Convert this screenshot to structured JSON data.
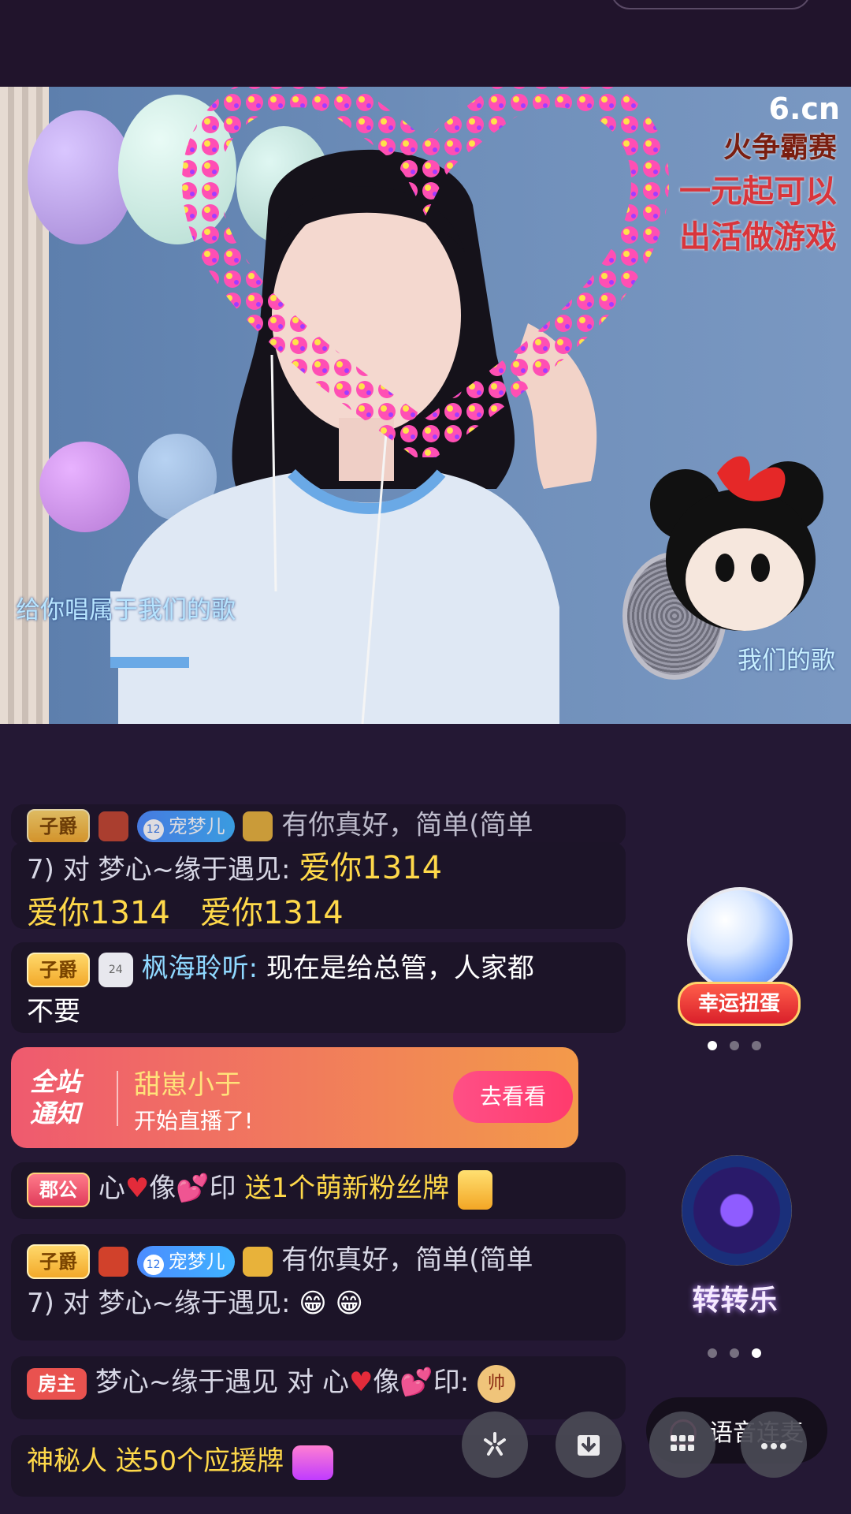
{
  "video": {
    "caption_left": "给你唱属于我们的歌",
    "caption_right": "我们的歌",
    "watermark": "6.cn",
    "promo": [
      "火争霸赛",
      "一元起可以",
      "出活做游戏"
    ]
  },
  "chat": {
    "partial_top": "有你真好，简单(简单",
    "msg1": {
      "line1_prefix": "7) 对 梦心~缘于遇见:",
      "line1_gift": "爱你1314",
      "line2": "爱你1314   爱你1314"
    },
    "msg2": {
      "badge": "子爵",
      "level": "24",
      "name": "枫海聆听:",
      "text": "现在是给总管，人家都",
      "text2": "不要"
    },
    "notice": {
      "tag_line1": "全站",
      "tag_line2": "通知",
      "name": "甜崽小于",
      "status": "开始直播了!",
      "button": "去看看"
    },
    "msg3": {
      "badge": "郡公",
      "name_a": "心",
      "name_b": "像",
      "name_c": "印",
      "gift_text": "送1个萌新粉丝牌"
    },
    "msg4": {
      "badge": "子爵",
      "chong_level": "12",
      "chong_name": "宠梦儿",
      "text": "有你真好，简单(简单",
      "line2": "7) 对 梦心~缘于遇见:"
    },
    "msg5": {
      "badge": "房主",
      "name": "梦心~缘于遇见",
      "mid": "对",
      "target_a": "心",
      "target_b": "像",
      "target_c": "印:",
      "coin": "帅"
    },
    "msg6": {
      "name": "神秘人",
      "gift_text": "送50个应援牌"
    }
  },
  "widgets": {
    "lucky_egg_label": "幸运扭蛋",
    "spin_label": "转转乐",
    "voice_label": "语音连麦"
  }
}
